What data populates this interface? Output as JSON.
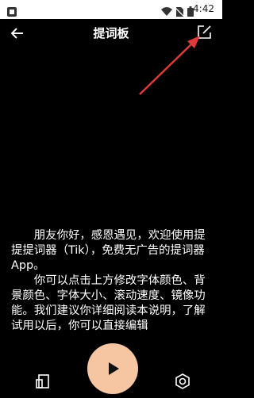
{
  "status_bar": {
    "time": "4:42",
    "icons": [
      "app-icon",
      "wifi-icon",
      "no-sim-icon",
      "battery-icon"
    ]
  },
  "app_bar": {
    "title": "提词板",
    "back_icon": "arrow-left-icon",
    "edit_icon": "edit-icon"
  },
  "annotation": {
    "arrow_color": "#e03a3a"
  },
  "content": {
    "paragraphs": [
      "朋友你好，感恩遇见，欢迎使用提提提词器（Tik），免费无广告的提词器App。",
      "你可以点击上方修改字体颜色、背景颜色、字体大小、滚动速度、镜像功能。我们建议你详细阅读本说明，了解试用以后，你可以直接编辑"
    ]
  },
  "bottom_bar": {
    "left_icon": "mirror-icon",
    "play_icon": "play-icon",
    "right_icon": "settings-icon",
    "play_color": "#f6c6a2"
  }
}
